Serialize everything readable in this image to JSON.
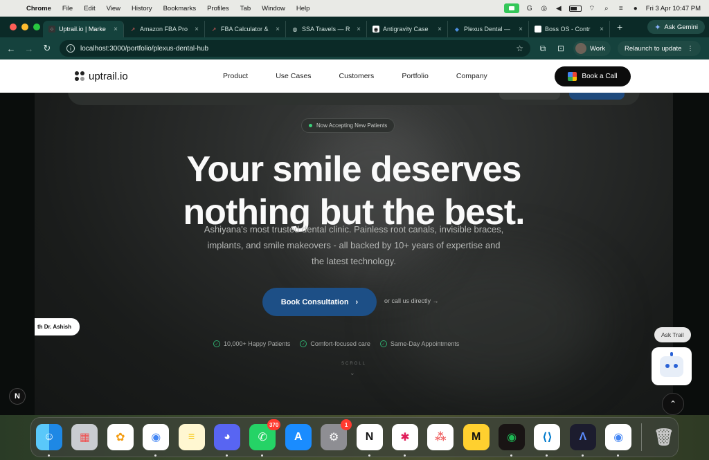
{
  "menubar": {
    "app_name": "Chrome",
    "menus": [
      "File",
      "Edit",
      "View",
      "History",
      "Bookmarks",
      "Profiles",
      "Tab",
      "Window",
      "Help"
    ],
    "datetime": "Fri 3 Apr  10:47 PM"
  },
  "browser": {
    "tabs": [
      {
        "title": "Uptrail.io | Marke",
        "icon": "uptrail-icon"
      },
      {
        "title": "Amazon FBA Pro",
        "icon": "chart-icon"
      },
      {
        "title": "FBA Calculator &",
        "icon": "chart-icon"
      },
      {
        "title": "SSA Travels — R",
        "icon": "globe-icon"
      },
      {
        "title": "Antigravity Case",
        "icon": "antigravity-icon"
      },
      {
        "title": "Plexus Dental —",
        "icon": "tooth-icon"
      },
      {
        "title": "Boss OS - Contr",
        "icon": "doc-icon"
      }
    ],
    "ask_gemini": "Ask Gemini",
    "url": "localhost:3000/portfolio/plexus-dental-hub",
    "profile_label": "Work",
    "relaunch_label": "Relaunch to update"
  },
  "site": {
    "logo_text": "uptrail.io",
    "nav": [
      "Product",
      "Use Cases",
      "Customers",
      "Portfolio",
      "Company"
    ],
    "book_call": "Book a Call"
  },
  "hero": {
    "badge": "Now Accepting New Patients",
    "headline_line1": "Your smile deserves",
    "headline_line2": "nothing but the best.",
    "subtext": "Ashiyana's most trusted dental clinic. Painless root canals, invisible braces, implants, and smile makeovers - all backed by 10+ years of expertise and the latest technology.",
    "cta": "Book Consultation",
    "call_link": "or call us directly →",
    "doctor_tag": "th Dr. Ashish",
    "trust": [
      "10,000+ Happy Patients",
      "Comfort-focused care",
      "Same-Day Appointments"
    ],
    "scroll_label": "SCROLL"
  },
  "widgets": {
    "ask_trail": "Ask Trail",
    "nextjs_badge": "N"
  },
  "dock": {
    "apps": [
      {
        "name": "Finder",
        "badge": ""
      },
      {
        "name": "Launchpad",
        "badge": ""
      },
      {
        "name": "Photos",
        "badge": ""
      },
      {
        "name": "Chrome",
        "badge": ""
      },
      {
        "name": "Notes",
        "badge": ""
      },
      {
        "name": "Discord",
        "badge": ""
      },
      {
        "name": "WhatsApp",
        "badge": "370"
      },
      {
        "name": "App Store",
        "badge": ""
      },
      {
        "name": "System Settings",
        "badge": "1"
      },
      {
        "name": "Notion",
        "badge": ""
      },
      {
        "name": "Slack",
        "badge": ""
      },
      {
        "name": "Asana",
        "badge": ""
      },
      {
        "name": "Miro",
        "badge": ""
      },
      {
        "name": "Spotify",
        "badge": ""
      },
      {
        "name": "VS Code",
        "badge": ""
      },
      {
        "name": "Arc",
        "badge": ""
      },
      {
        "name": "Chrome",
        "badge": ""
      },
      {
        "name": "Trash",
        "badge": ""
      }
    ]
  }
}
